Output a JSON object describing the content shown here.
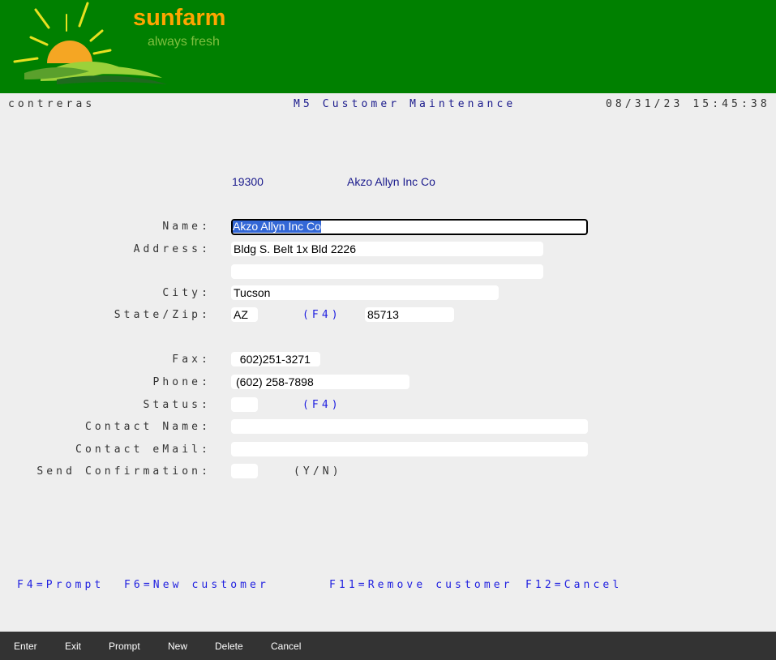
{
  "brand": {
    "name": "sunfarm",
    "tagline": "always fresh"
  },
  "colors": {
    "header_bg": "#008000",
    "brand_orange": "#ffa500",
    "tagline_green": "#7fbf3f",
    "footer_bg": "#333333",
    "hint_blue": "#2020e0",
    "title_blue": "#1a1a8c"
  },
  "status_bar": {
    "user": "contreras",
    "title": "M5 Customer Maintenance",
    "datetime": "08/31/23 15:45:38"
  },
  "customer": {
    "number": "19300",
    "name_display": "Akzo Allyn Inc Co"
  },
  "form": {
    "labels": {
      "name": "Name:",
      "address": "Address:",
      "city": "City:",
      "state_zip": "State/Zip:",
      "fax": "Fax:",
      "phone": "Phone:",
      "status": "Status:",
      "contact_name": "Contact Name:",
      "contact_email": "Contact eMail:",
      "send_confirmation": "Send Confirmation:"
    },
    "values": {
      "name": "Akzo Allyn Inc Co",
      "address1": "Bldg S. Belt 1x Bld 2226",
      "address2": "",
      "city": "Tucson",
      "state": "AZ",
      "zip": "85713",
      "fax": "  602)251-3271",
      "phone": "(602) 258-7898",
      "status": "",
      "contact_name": "",
      "contact_email": "",
      "send_confirmation": ""
    },
    "hints": {
      "state_prompt": "(F4)",
      "status_prompt": "(F4)",
      "yes_no": "(Y/N)"
    }
  },
  "function_keys": {
    "f4": "F4=Prompt",
    "f6": "F6=New customer",
    "f11": "F11=Remove customer",
    "f12": "F12=Cancel"
  },
  "footer_buttons": {
    "enter": "Enter",
    "exit": "Exit",
    "prompt": "Prompt",
    "new": "New",
    "delete": "Delete",
    "cancel": "Cancel"
  }
}
